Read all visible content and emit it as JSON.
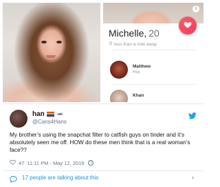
{
  "tinder": {
    "name": "Michelle,",
    "age": "20",
    "distance": "less than a mile away",
    "messages": [
      {
        "name": "Matthew",
        "text": "Hey"
      },
      {
        "name": "Khan",
        "text": ""
      }
    ],
    "info_symbol": "i"
  },
  "tweet": {
    "display_name": "han",
    "handle": "@Cans4Hans",
    "text": "My brother’s using the snapchat filter to catfish guys on tinder and it’s absolutely seen me off. HOW do these men think that is a real woman’s face??",
    "likes": "47",
    "timestamp": "11:11 PM - May 12, 2019",
    "info_symbol": "i"
  },
  "footer": {
    "talking": "17 people are talking about this"
  },
  "icons": {
    "heart_fab": "heart-icon",
    "location": "location-pin-icon",
    "twitter": "twitter-bird-icon",
    "like": "heart-outline-icon",
    "comment": "comment-icon",
    "chevron": "chevron-right-icon"
  },
  "colors": {
    "tinder_gradient_start": "#ff5a6a",
    "tinder_gradient_end": "#f53d5d",
    "twitter_blue": "#1da1f2",
    "link_blue": "#1b95e0",
    "muted": "#657786"
  }
}
